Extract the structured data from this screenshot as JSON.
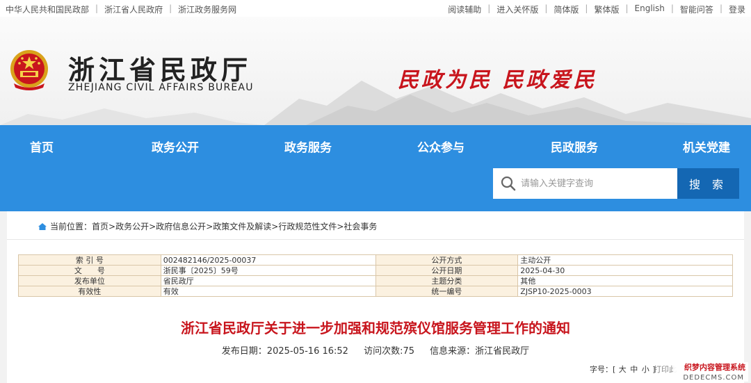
{
  "topbar": {
    "left_links": [
      "中华人民共和国民政部",
      "浙江省人民政府",
      "浙江政务服务网"
    ],
    "right_links": [
      "阅读辅助",
      "进入关怀版",
      "简体版",
      "繁体版",
      "English",
      "智能问答",
      "登录"
    ]
  },
  "header": {
    "title": "浙江省民政厅",
    "subtitle": "ZHEJIANG CIVIL AFFAIRS BUREAU",
    "slogan": "民政为民  民政爱民"
  },
  "nav": [
    "首页",
    "政务公开",
    "政务服务",
    "公众参与",
    "民政服务",
    "机关党建"
  ],
  "search": {
    "placeholder": "请输入关键字查询",
    "button": "搜 索"
  },
  "breadcrumb": {
    "prefix": "当前位置：",
    "items": [
      "首页",
      "政务公开",
      "政府信息公开",
      "政策文件及解读",
      "行政规范性文件",
      "社会事务"
    ]
  },
  "meta_table": [
    {
      "k1": "索 引 号",
      "v1": "002482146/2025-00037",
      "k2": "公开方式",
      "v2": "主动公开"
    },
    {
      "k1": "文　　号",
      "v1": "浙民事〔2025〕59号",
      "k2": "公开日期",
      "v2": "2025-04-30"
    },
    {
      "k1": "发布单位",
      "v1": "省民政厅",
      "k2": "主题分类",
      "v2": "其他"
    },
    {
      "k1": "有效性",
      "v1": "有效",
      "k2": "统一编号",
      "v2": "ZJSP10-2025-0003"
    }
  ],
  "article": {
    "title": "浙江省民政厅关于进一步加强和规范殡仪馆服务管理工作的通知",
    "publish_date": "发布日期：2025-05-16 16:52",
    "visits": "访问次数:75",
    "source": "信息来源：浙江省民政厅",
    "font_size_label": "字号：[",
    "font_sizes": [
      "大",
      "中",
      "小"
    ],
    "font_size_end": "]",
    "print": "打印此"
  },
  "watermark": {
    "line1": "织梦内容管理系统",
    "line2": "DEDECMS.COM"
  },
  "colors": {
    "nav_blue": "#2d8ee0",
    "search_button": "#1467b3",
    "title_red": "#c8151d",
    "table_key_bg": "#fbf1e0"
  }
}
